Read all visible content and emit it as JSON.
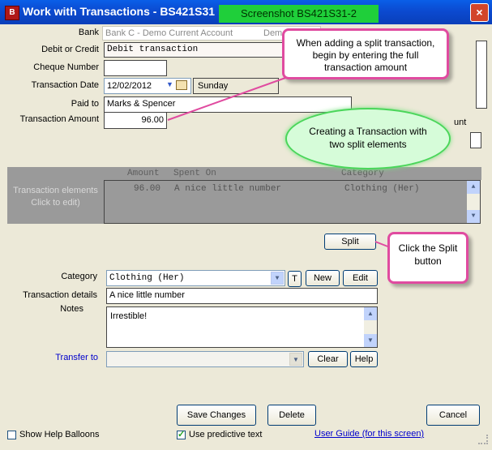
{
  "window": {
    "title": "Work with Transactions - BS421S31",
    "screenshot_badge": "Screenshot BS421S31-2",
    "close_glyph": "×"
  },
  "form": {
    "bank_label": "Bank",
    "bank_value": "Bank C - Demo Current Account",
    "bank_value_trailing": "Demo",
    "debit_credit_label": "Debit or Credit",
    "debit_credit_value": "Debit transaction",
    "cheque_label": "Cheque Number",
    "cheque_value": "",
    "date_label": "Transaction Date",
    "date_value": "12/02/2012",
    "day_value": "Sunday",
    "paid_to_label": "Paid to",
    "paid_to_value": "Marks & Spencer",
    "amount_label": "Transaction Amount",
    "amount_value": "96.00",
    "amount_right_text": "unt"
  },
  "elements": {
    "label": "Transaction elements\nClick to edit)",
    "col_amount": "Amount",
    "col_spent_on": "Spent On",
    "col_category": "Category",
    "row_amount": "96.00",
    "row_spent_on": "A nice little number",
    "row_category": "Clothing (Her)"
  },
  "split": {
    "button_label": "Split"
  },
  "detail": {
    "category_label": "Category",
    "category_value": "Clothing (Her)",
    "t_button": "T",
    "new_button": "New",
    "edit_button": "Edit",
    "details_label": "Transaction details",
    "details_value": "A nice little number",
    "notes_label": "Notes",
    "notes_value": "Irrestible!",
    "transfer_label": "Transfer to",
    "transfer_value": "",
    "clear_button": "Clear",
    "help_button": "Help"
  },
  "footer": {
    "save_button": "Save Changes",
    "delete_button": "Delete",
    "cancel_button": "Cancel",
    "help_balloons_label": "Show Help Balloons",
    "help_balloons_checked": false,
    "predictive_label": "Use predictive text",
    "predictive_checked": true,
    "user_guide_link": "User Guide (for this screen)"
  },
  "callouts": {
    "split_amount": "When adding a split transaction, begin by entering the full transaction amount",
    "cloud": "Creating a Transaction with two split elements",
    "split_button": "Click the Split button"
  },
  "colors": {
    "title_bar": "#0a4ad0",
    "badge": "#1fcf3a",
    "callout_border": "#e04ba0",
    "cloud_fill": "#d6fcd9"
  }
}
